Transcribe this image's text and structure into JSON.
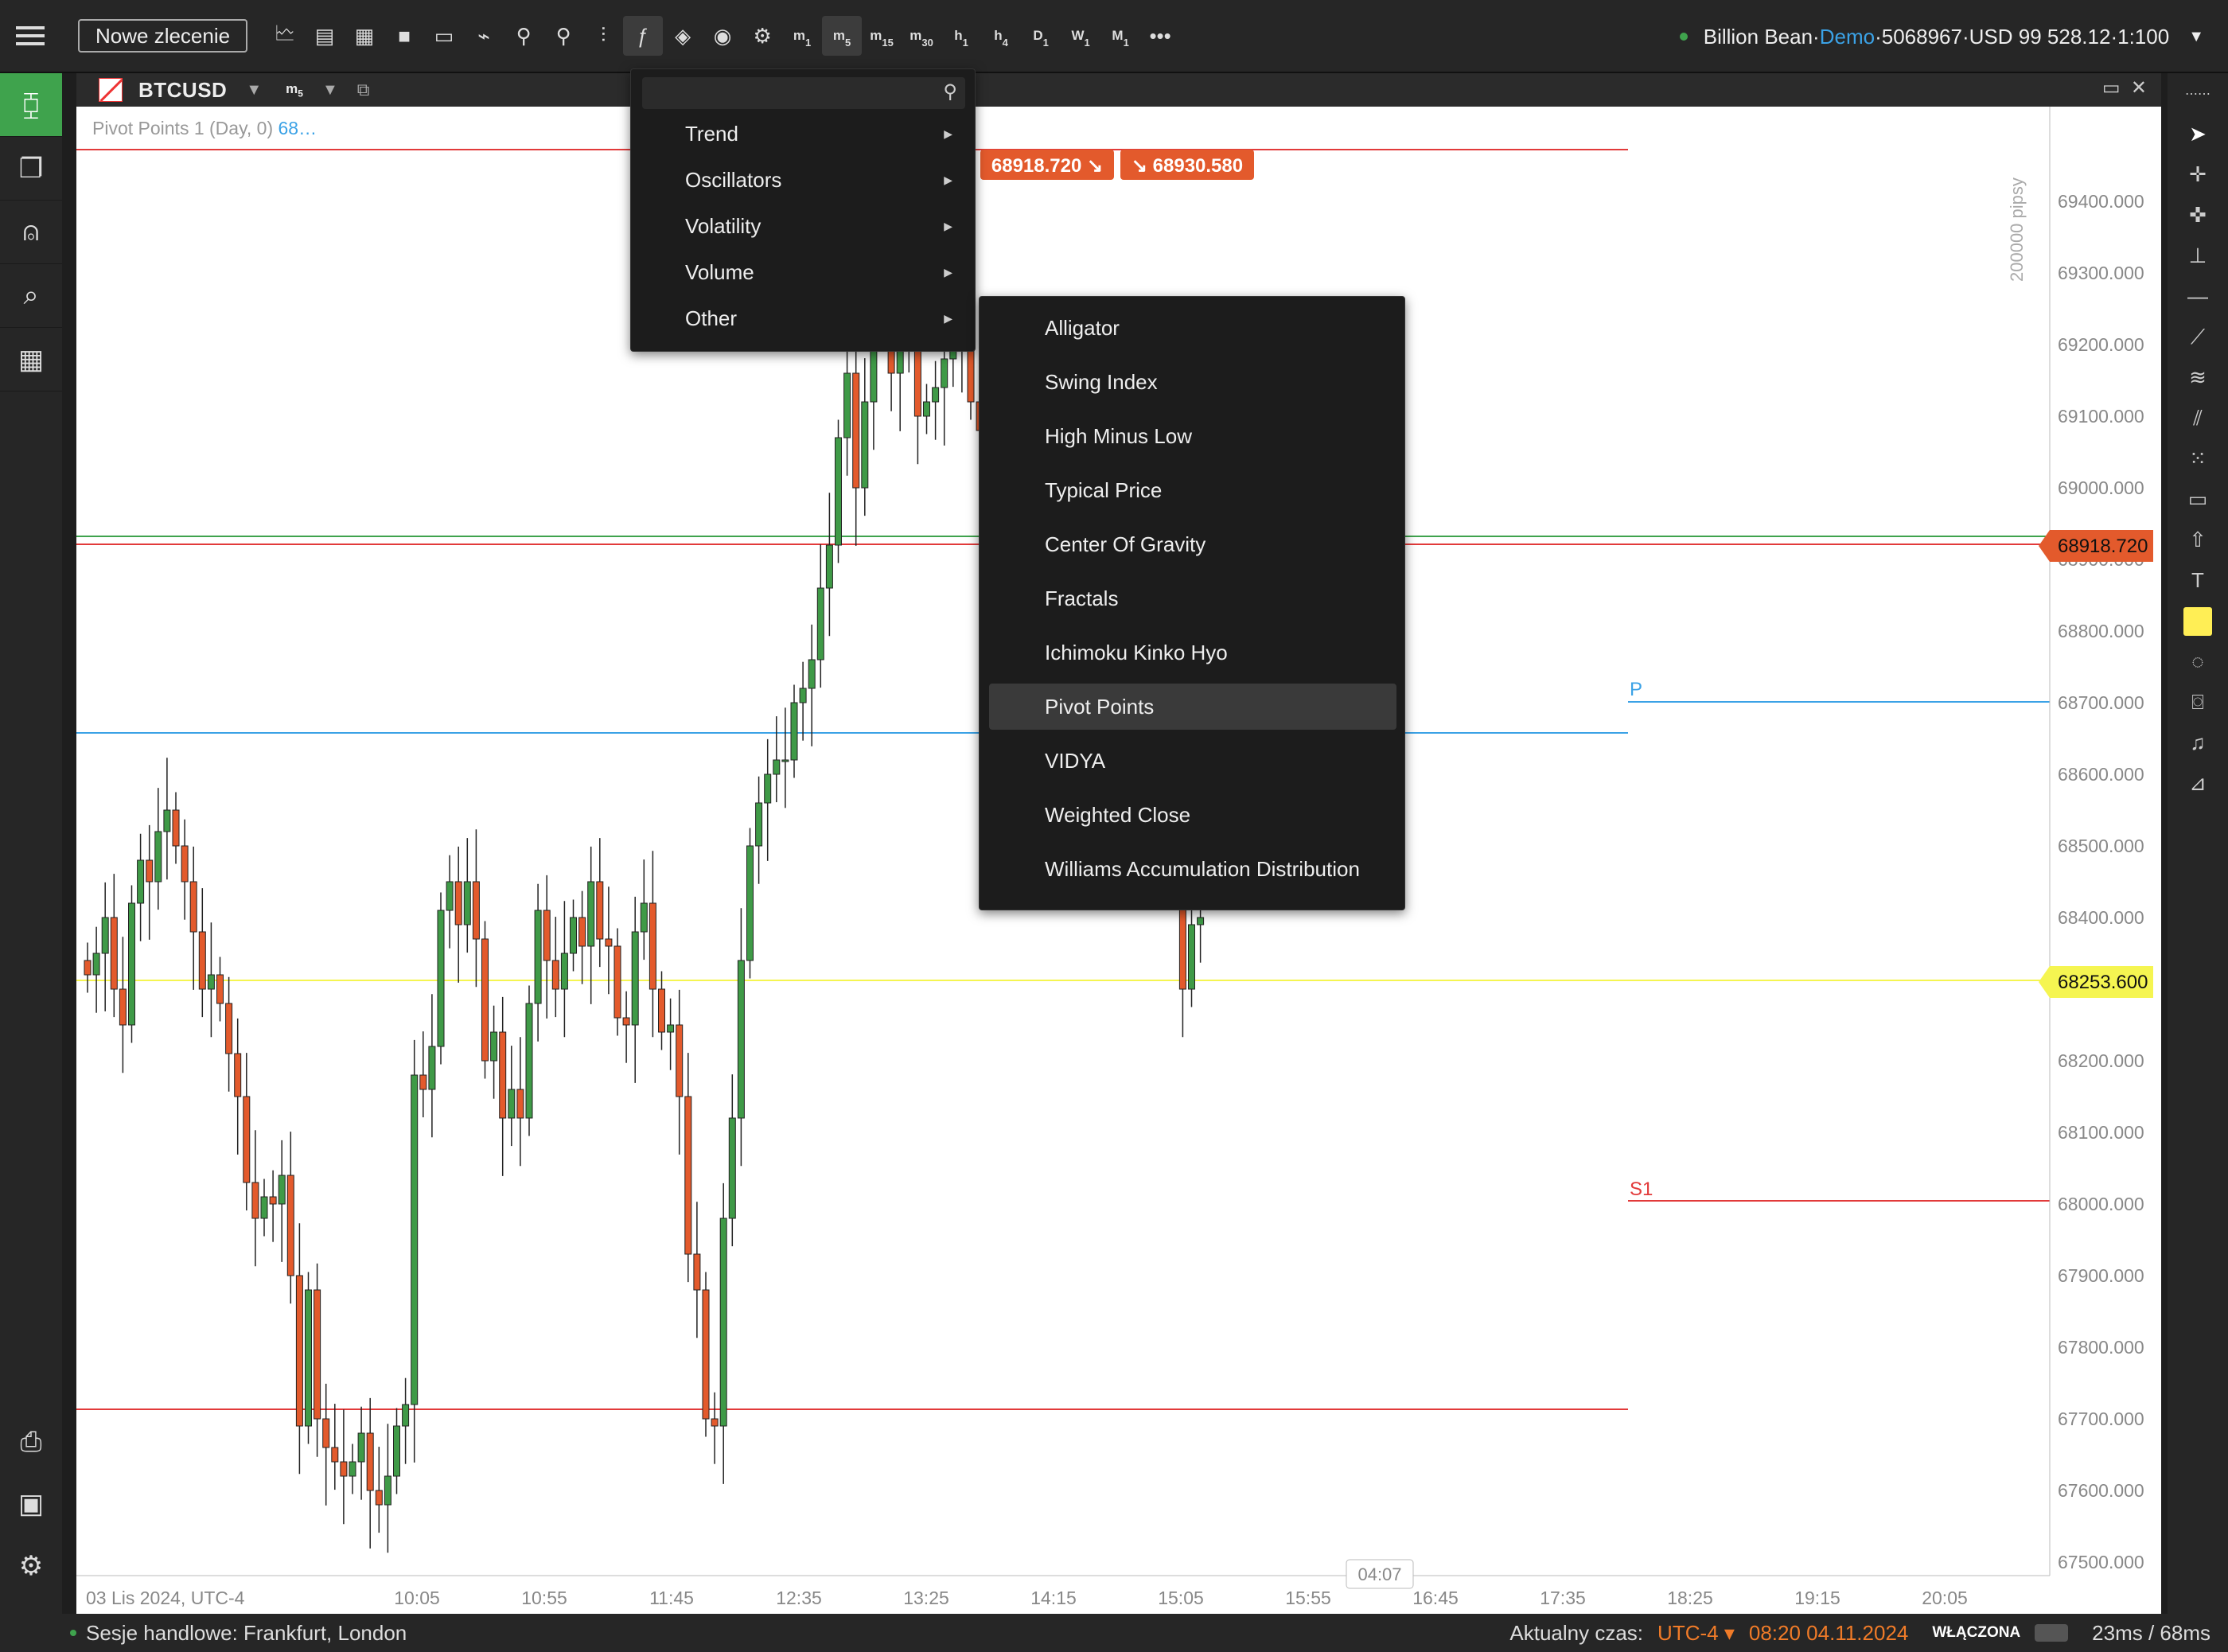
{
  "topbar": {
    "new_order": "Nowe zlecenie",
    "timeframes": [
      {
        "base": "m",
        "sub": "1"
      },
      {
        "base": "m",
        "sub": "5"
      },
      {
        "base": "m",
        "sub": "15"
      },
      {
        "base": "m",
        "sub": "30"
      },
      {
        "base": "h",
        "sub": "1"
      },
      {
        "base": "h",
        "sub": "4"
      },
      {
        "base": "D",
        "sub": "1"
      },
      {
        "base": "W",
        "sub": "1"
      },
      {
        "base": "M",
        "sub": "1"
      }
    ],
    "account_name": "Billion Bean",
    "account_mode": "Demo",
    "account_id": "5068967",
    "balance": "USD 99 528.12",
    "leverage": "1:100",
    "sep": "·"
  },
  "chart": {
    "symbol": "BTCUSD",
    "timeframe_base": "m",
    "timeframe_sub": "5",
    "legend_label": "Pivot Points 1 (Day, 0)",
    "legend_value": "68…",
    "bid_badge": "68918.720",
    "ask_badge": "68930.580",
    "pips_label": "200000 pipsy",
    "timer": "04:07",
    "date_label": "03 Lis 2024, UTC-4",
    "time_labels": [
      "10:05",
      "10:55",
      "11:45",
      "12:35",
      "13:25",
      "14:15",
      "15:05",
      "15:55",
      "16:45",
      "17:35",
      "18:25",
      "19:15",
      "20:05"
    ],
    "price_labels": [
      "69400.000",
      "69300.000",
      "69200.000",
      "69100.000",
      "69000.000",
      "68900.000",
      "68800.000",
      "68700.000",
      "68600.000",
      "68500.000",
      "68400.000",
      "68300.000",
      "68200.000",
      "68100.000",
      "68000.000",
      "67900.000",
      "67800.000",
      "67700.000",
      "67600.000",
      "67500.000"
    ],
    "price_tag_current": "68918.720",
    "price_tag_yellow": "68253.600",
    "pivot_label_p": "P",
    "pivot_label_s1": "S1",
    "colors": {
      "up": "#3f9a47",
      "down": "#e35a2c",
      "pivot_p": "#3ba2e6",
      "resistance": "#e23a3a",
      "bid_line": "#3fa34d",
      "yellow": "#f5f551"
    }
  },
  "menu_main": {
    "items": [
      {
        "label": "Trend",
        "arrow": "▶"
      },
      {
        "label": "Oscillators",
        "arrow": "▶"
      },
      {
        "label": "Volatility",
        "arrow": "▶"
      },
      {
        "label": "Volume",
        "arrow": "▶"
      },
      {
        "label": "Other",
        "arrow": "▶"
      }
    ]
  },
  "menu_sub": {
    "items": [
      "Alligator",
      "Swing Index",
      "High Minus Low",
      "Typical Price",
      "Center Of Gravity",
      "Fractals",
      "Ichimoku Kinko Hyo",
      "Pivot Points",
      "VIDYA",
      "Weighted Close",
      "Williams Accumulation Distribution"
    ],
    "highlighted": "Pivot Points"
  },
  "status": {
    "sessions": "Sesje handlowe: Frankfurt, London",
    "current_time_label": "Aktualny czas:",
    "timezone": "UTC-4 ▾",
    "datetime": "08:20 04.11.2024",
    "enabled": "WŁĄCZONA",
    "latency": "23ms / 68ms"
  },
  "icons": {
    "left": [
      "candles-icon",
      "copy-icon",
      "robot-icon",
      "market-search-icon",
      "layout-icon"
    ],
    "left_bottom": [
      "printer-icon",
      "wallet-icon",
      "gear-icon",
      "help-icon"
    ]
  }
}
